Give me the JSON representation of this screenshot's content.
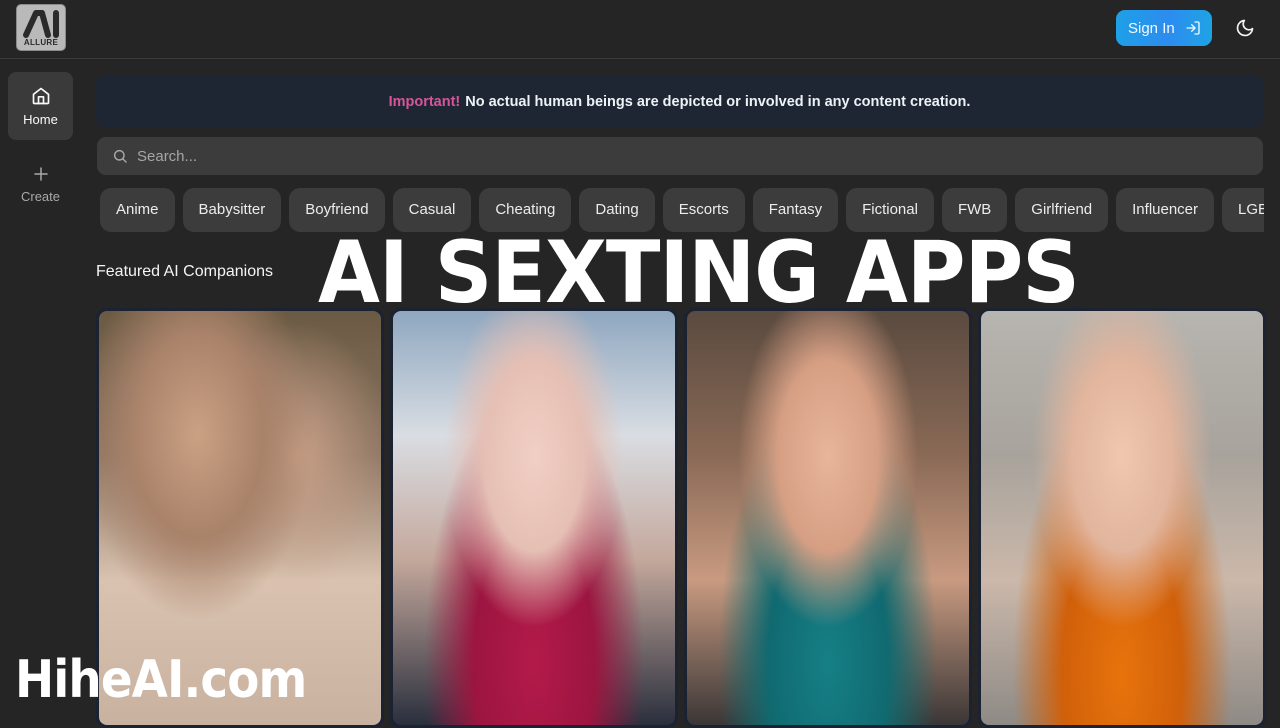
{
  "header": {
    "logo_text": "ALLURE",
    "logo_mark": "AI",
    "sign_in_label": "Sign In",
    "sign_in_icon": "log-in-icon",
    "theme_toggle_icon": "moon-icon",
    "accent_gradient": [
      "#1ea0e6",
      "#2d8cf0"
    ]
  },
  "sidebar": {
    "items": [
      {
        "label": "Home",
        "icon": "home-icon",
        "active": true
      },
      {
        "label": "Create",
        "icon": "plus-icon",
        "active": false
      }
    ]
  },
  "banner": {
    "highlight": "Important!",
    "message": "No actual human beings are depicted or involved in any content creation.",
    "highlight_color": "#d6559a"
  },
  "search": {
    "placeholder": "Search...",
    "value": ""
  },
  "categories": [
    "Anime",
    "Babysitter",
    "Boyfriend",
    "Casual",
    "Cheating",
    "Dating",
    "Escorts",
    "Fantasy",
    "Fictional",
    "FWB",
    "Girlfriend",
    "Influencer",
    "LGBTQ"
  ],
  "featured": {
    "title": "Featured AI Companions",
    "cards": [
      {
        "alt": "AI companion portrait 1"
      },
      {
        "alt": "AI companion portrait 2"
      },
      {
        "alt": "AI companion portrait 3"
      },
      {
        "alt": "AI companion portrait 4"
      }
    ]
  },
  "overlay": {
    "title": "AI SEXTING APPS",
    "watermark": "HiheAI.com"
  }
}
